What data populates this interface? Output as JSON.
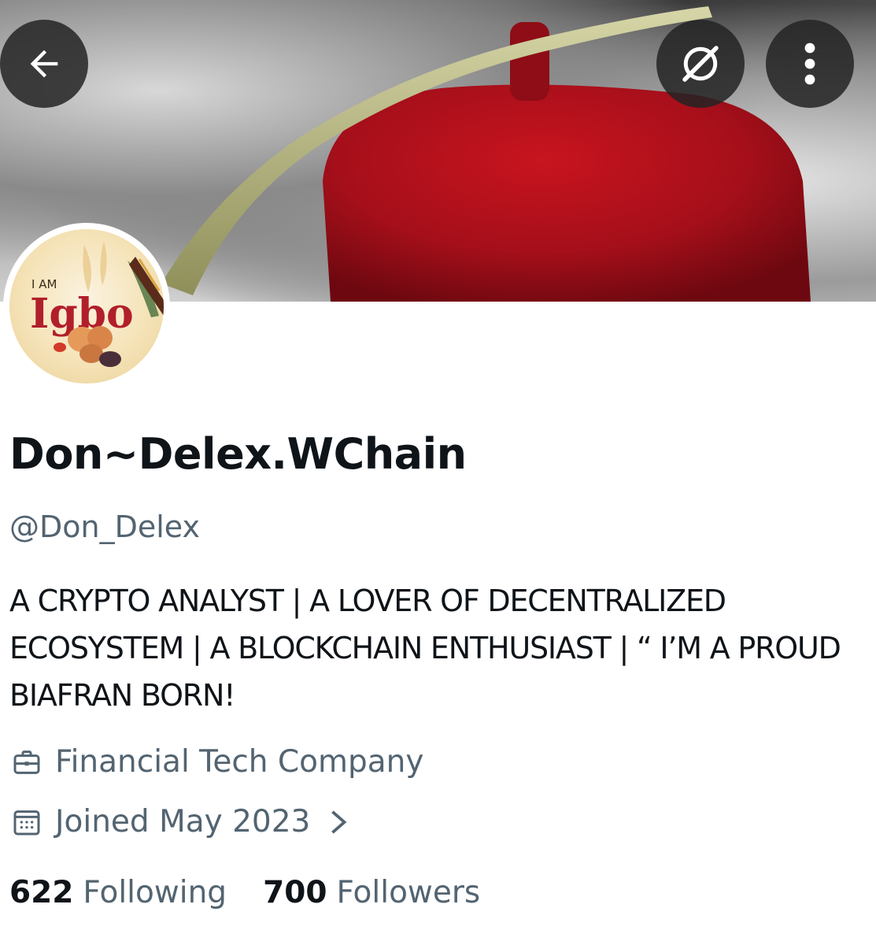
{
  "header": {
    "back_icon": "arrow-left-icon",
    "grok_icon": "grok-icon",
    "more_icon": "more-vertical-icon"
  },
  "avatar": {
    "text_top": "I AM",
    "text_main": "Igbo"
  },
  "profile": {
    "display_name": "Don~Delex.WChain",
    "handle": "@Don_Delex",
    "bio": "A CRYPTO ANALYST | A LOVER OF DECENTRALIZED ECOSYSTEM | A BLOCKCHAIN ENTHUSIAST | “ I’M A PROUD BIAFRAN BORN!",
    "profession": "Financial Tech Company",
    "joined": "Joined May 2023"
  },
  "stats": {
    "following_count": "622",
    "following_label": "Following",
    "followers_count": "700",
    "followers_label": "Followers"
  },
  "colors": {
    "primary_text": "#0f1419",
    "secondary_text": "#536471",
    "hat_red": "#b0121d"
  }
}
